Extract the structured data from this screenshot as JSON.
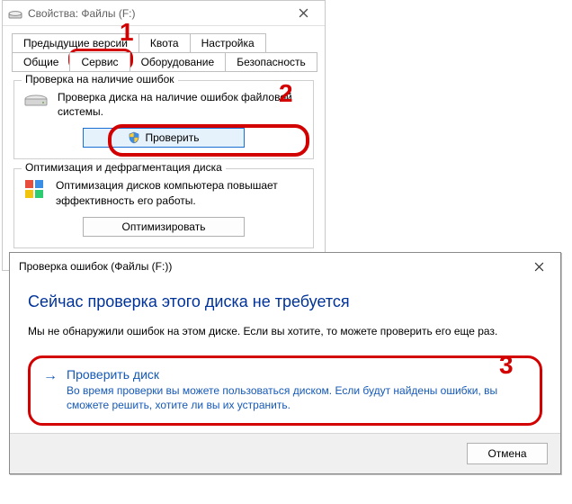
{
  "props": {
    "title": "Свойства: Файлы (F:)",
    "tabs_row1": [
      "Предыдущие версии",
      "Квота",
      "Настройка"
    ],
    "tabs_row2": [
      "Общие",
      "Сервис",
      "Оборудование",
      "Безопасность"
    ],
    "active_tab": "Сервис",
    "check": {
      "legend": "Проверка на наличие ошибок",
      "desc": "Проверка диска на наличие ошибок файловой системы.",
      "button": "Проверить"
    },
    "defrag": {
      "legend": "Оптимизация и дефрагментация диска",
      "desc": "Оптимизация дисков компьютера повышает эффективность его работы.",
      "button": "Оптимизировать"
    }
  },
  "dialog": {
    "title": "Проверка ошибок (Файлы (F:))",
    "heading": "Сейчас проверка этого диска не требуется",
    "text": "Мы не обнаружили ошибок на этом диске. Если вы хотите, то можете проверить его еще раз.",
    "link_title": "Проверить диск",
    "link_sub": "Во время проверки вы можете пользоваться диском. Если будут найдены ошибки, вы сможете решить, хотите ли вы их устранить.",
    "cancel": "Отмена"
  },
  "annotations": {
    "n1": "1",
    "n2": "2",
    "n3": "3"
  }
}
